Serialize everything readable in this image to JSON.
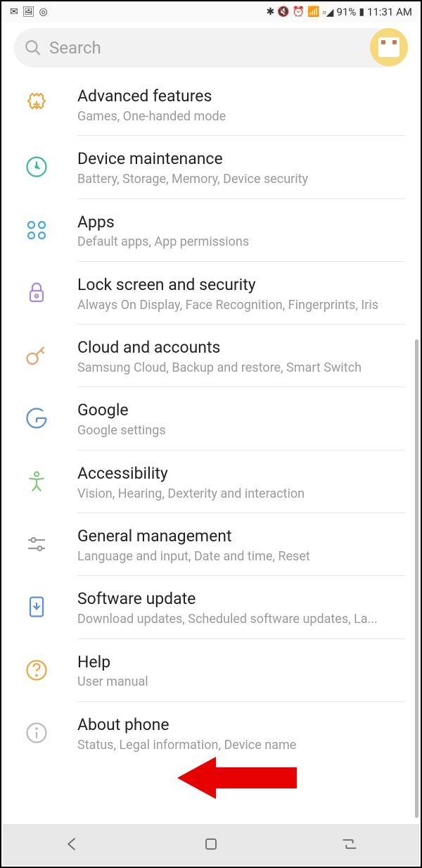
{
  "status_bar": {
    "icons_left": [
      "✉",
      "🖼",
      "◎"
    ],
    "bluetooth": "✱",
    "mute": "🔇",
    "alarm": "⏰",
    "wifi": "📶",
    "signal": "📶",
    "battery_text": "91%",
    "battery_icon": "▮",
    "time": "11:31 AM"
  },
  "search": {
    "placeholder": "Search"
  },
  "settings": [
    {
      "id": "advanced-features",
      "title": "Advanced features",
      "subtitle": "Games, One-handed mode"
    },
    {
      "id": "device-maintenance",
      "title": "Device maintenance",
      "subtitle": "Battery, Storage, Memory, Device security"
    },
    {
      "id": "apps",
      "title": "Apps",
      "subtitle": "Default apps, App permissions"
    },
    {
      "id": "lock-screen-security",
      "title": "Lock screen and security",
      "subtitle": "Always On Display, Face Recognition, Fingerprints, Iris"
    },
    {
      "id": "cloud-accounts",
      "title": "Cloud and accounts",
      "subtitle": "Samsung Cloud, Backup and restore, Smart Switch"
    },
    {
      "id": "google",
      "title": "Google",
      "subtitle": "Google settings"
    },
    {
      "id": "accessibility",
      "title": "Accessibility",
      "subtitle": "Vision, Hearing, Dexterity and interaction"
    },
    {
      "id": "general-management",
      "title": "General management",
      "subtitle": "Language and input, Date and time, Reset"
    },
    {
      "id": "software-update",
      "title": "Software update",
      "subtitle": "Download updates, Scheduled software updates, La..."
    },
    {
      "id": "help",
      "title": "Help",
      "subtitle": "User manual"
    },
    {
      "id": "about-phone",
      "title": "About phone",
      "subtitle": "Status, Legal information, Device name"
    }
  ]
}
